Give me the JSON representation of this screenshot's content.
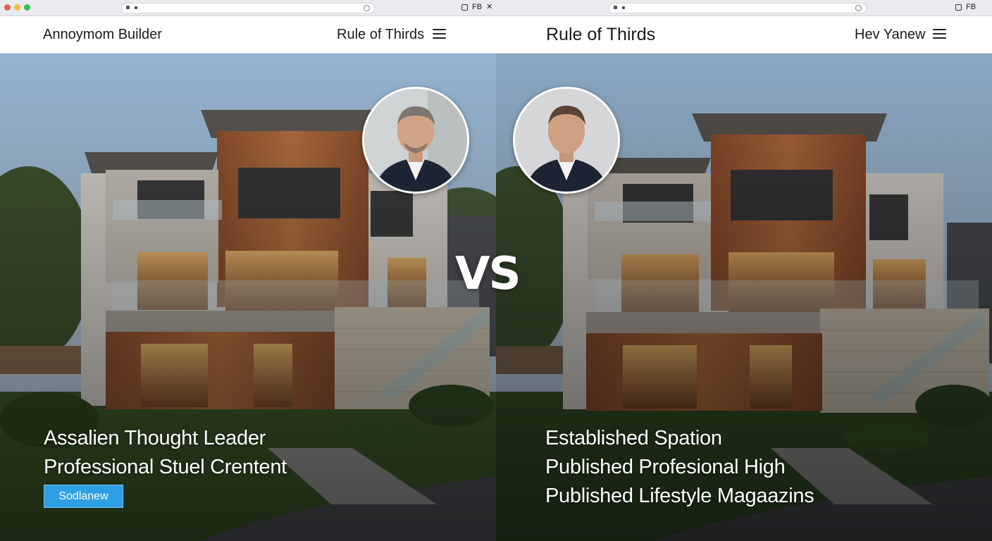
{
  "left": {
    "nav": {
      "brand": "Annoymom Builder",
      "title": "Rule of Thirds"
    },
    "headline": [
      "Assalien Thought Leader",
      "Professional Stuel Crentent"
    ],
    "cta": "Sodlanew",
    "chrome": {
      "icon_label": "FB"
    }
  },
  "right": {
    "nav": {
      "title": "Rule of Thirds",
      "link": "Hev Yanew"
    },
    "headline": [
      "Established Spation",
      "Published Profesional High",
      "Published Lifestyle Magaazins"
    ],
    "chrome": {
      "icon_label": "FB"
    }
  },
  "center_label": "VS",
  "icons": [
    "traffic-lights",
    "menu-icon",
    "close-icon",
    "tab-icon",
    "reader-icon"
  ],
  "colors": {
    "cta": "#2f9fe3",
    "nav_bg": "#ffffff",
    "sky": "#a9c3dc",
    "wood": "#a4613a"
  }
}
